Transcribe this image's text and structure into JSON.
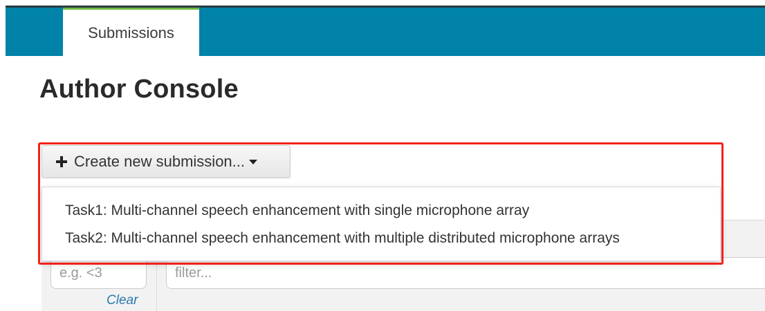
{
  "navbar": {
    "tabs": [
      {
        "label": "Submissions"
      }
    ]
  },
  "page": {
    "title": "Author Console"
  },
  "create_menu": {
    "button_label": "Create new submission...",
    "items": [
      {
        "label": "Task1: Multi-channel speech enhancement with single microphone array"
      },
      {
        "label": "Task2: Multi-channel speech enhancement with multiple distributed microphone arrays"
      }
    ]
  },
  "filters": {
    "number_placeholder": "e.g. <3",
    "clear_label": "Clear",
    "text_placeholder": "filter..."
  },
  "colors": {
    "navbar": "#0182a8",
    "active_tab_top": "#6fb83f",
    "highlight": "#f2221b",
    "link": "#2a7ab0"
  },
  "icons": {
    "create_button_icon": "plus-icon",
    "create_button_caret": "caret-down-icon"
  }
}
